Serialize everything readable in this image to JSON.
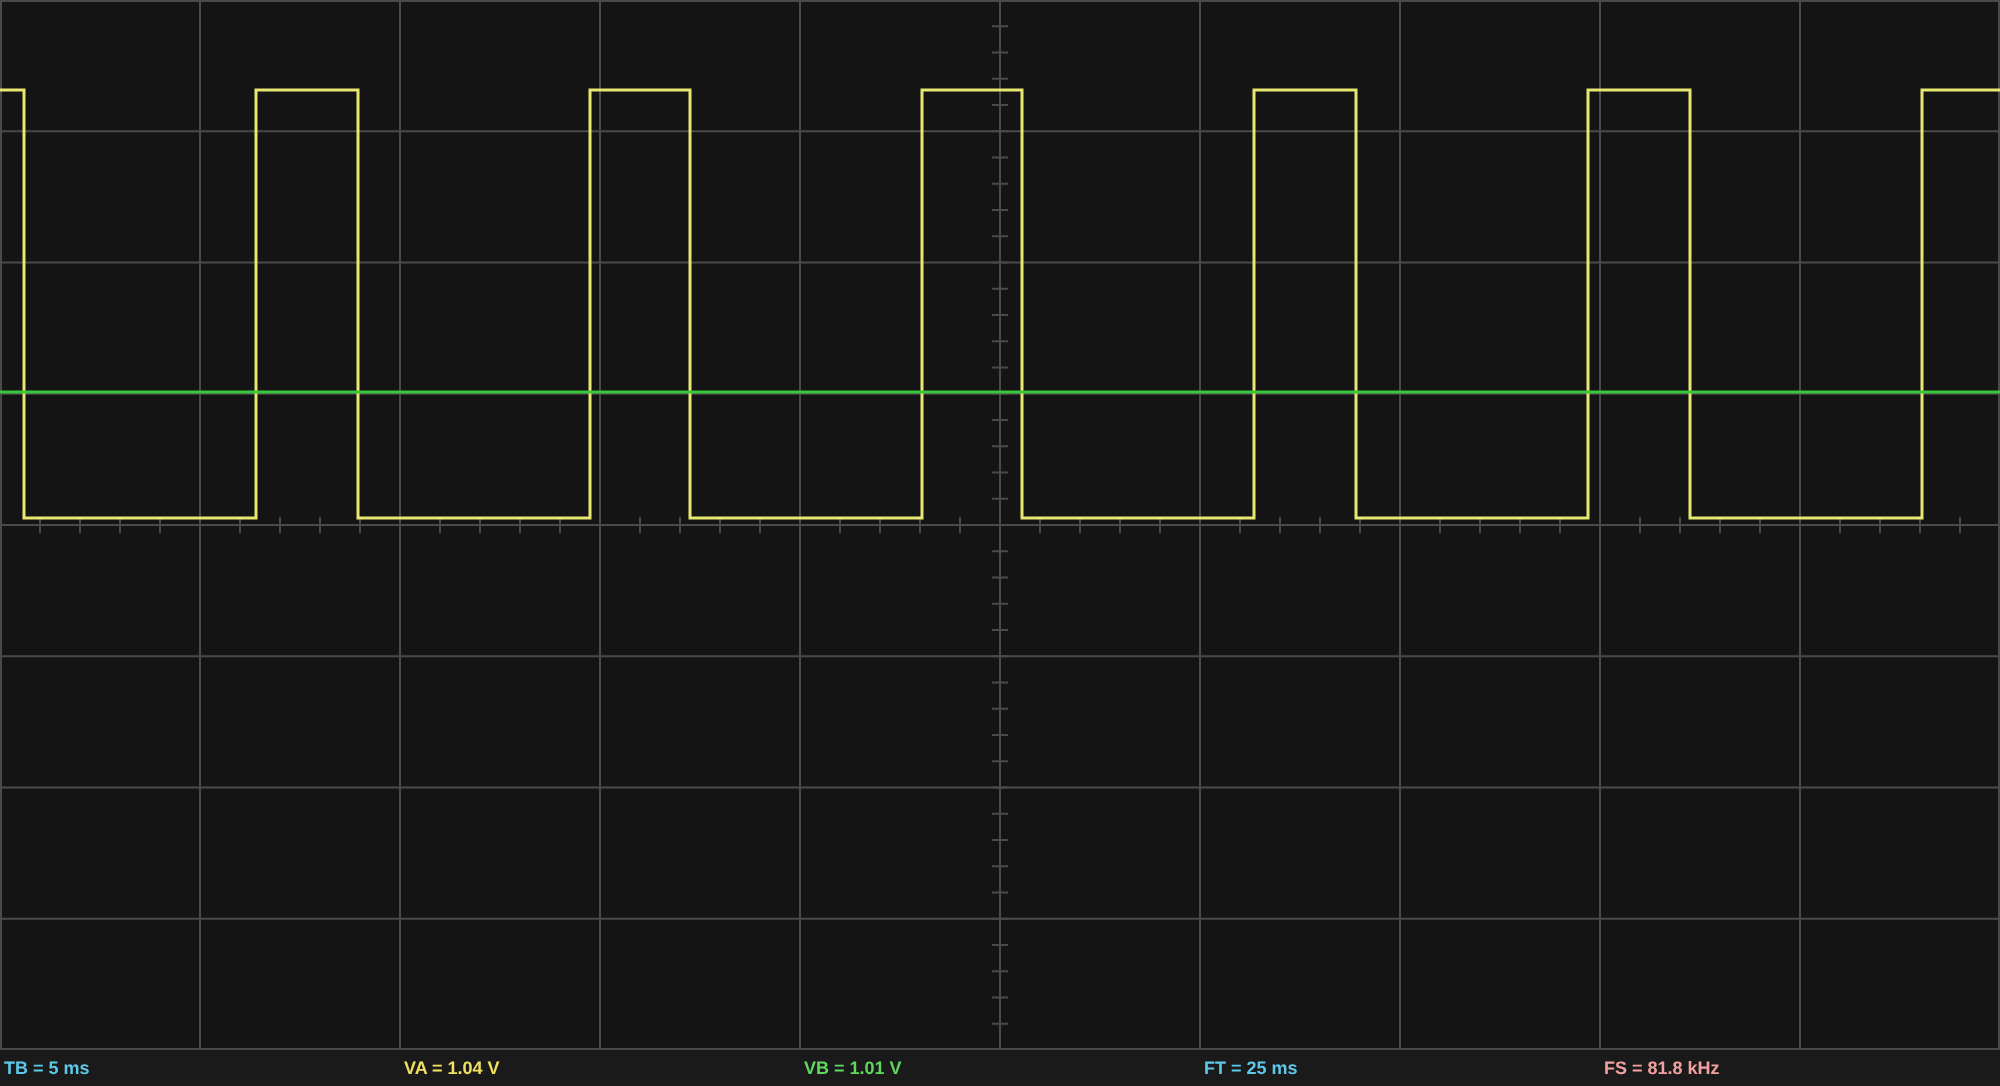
{
  "status_bar": [
    {
      "text": "TB = 5 ms",
      "color": "#5ec8e8"
    },
    {
      "text": "VA = 1.04 V",
      "color": "#f0e060"
    },
    {
      "text": "VB = 1.01 V",
      "color": "#60d860"
    },
    {
      "text": "FT = 25 ms",
      "color": "#5ec8e8"
    },
    {
      "text": "FS = 81.8 kHz",
      "color": "#f0a0a0"
    }
  ]
}
